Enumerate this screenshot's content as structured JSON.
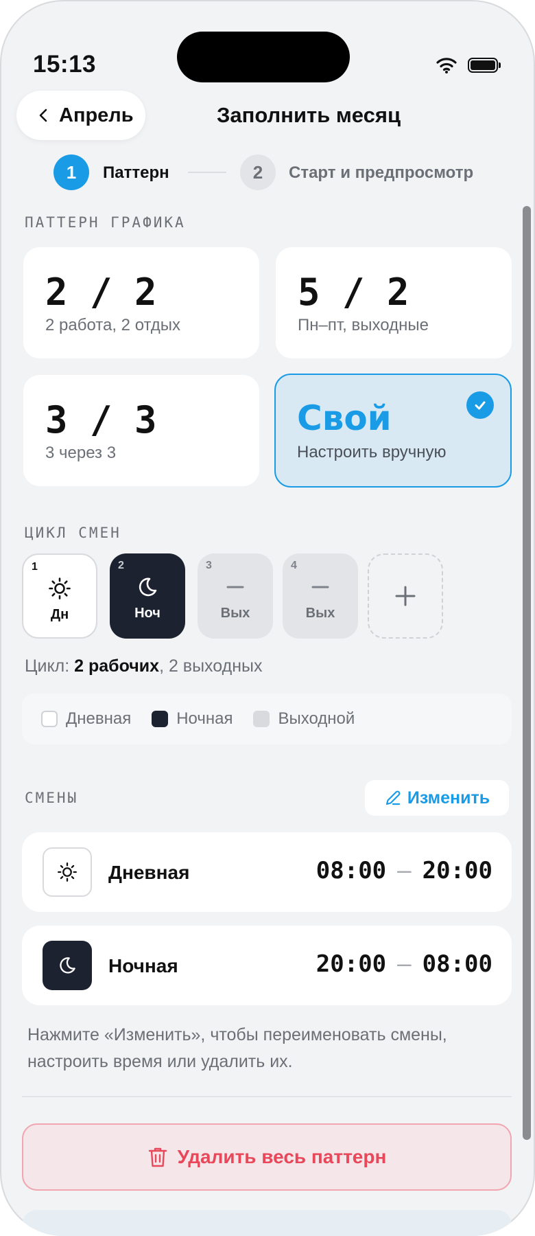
{
  "status_bar": {
    "time": "15:13"
  },
  "nav": {
    "back_label": "Апрель",
    "title": "Заполнить месяц"
  },
  "steps": [
    {
      "number": "1",
      "label": "Паттерн",
      "active": true
    },
    {
      "number": "2",
      "label": "Старт и предпросмотр",
      "active": false
    }
  ],
  "pattern_section": {
    "label": "ПАТТЕРН ГРАФИКА",
    "cards": [
      {
        "title": "2 / 2",
        "subtitle": "2 работа, 2 отдых"
      },
      {
        "title": "5 / 2",
        "subtitle": "Пн–пт, выходные"
      },
      {
        "title": "3 / 3",
        "subtitle": "3 через 3"
      },
      {
        "title": "Свой",
        "subtitle": "Настроить вручную",
        "selected": true
      }
    ]
  },
  "cycle_section": {
    "label": "ЦИКЛ СМЕН",
    "tiles": [
      {
        "number": "1",
        "label": "Дн",
        "icon": "sun-icon"
      },
      {
        "number": "2",
        "label": "Ноч",
        "icon": "moon-icon"
      },
      {
        "number": "3",
        "label": "Вых",
        "icon": "minus-icon"
      },
      {
        "number": "4",
        "label": "Вых",
        "icon": "minus-icon"
      }
    ],
    "add_icon": "plus-icon",
    "summary_prefix": "Цикл: ",
    "summary_bold": "2 рабочих",
    "summary_suffix": ", 2 выходных",
    "legend": [
      {
        "label": "Дневная",
        "color": "#ffffff"
      },
      {
        "label": "Ночная",
        "color": "#1c2230"
      },
      {
        "label": "Выходной",
        "color": "#d9dadd"
      }
    ]
  },
  "shifts_section": {
    "label": "СМЕНЫ",
    "edit_label": "Изменить",
    "shifts": [
      {
        "name": "Дневная",
        "start": "08:00",
        "dash": "—",
        "end": "20:00",
        "icon": "sun-icon"
      },
      {
        "name": "Ночная",
        "start": "20:00",
        "dash": "—",
        "end": "08:00",
        "icon": "moon-icon"
      }
    ],
    "hint": "Нажмите «Изменить», чтобы переименовать смены, настроить время или удалить их."
  },
  "delete_label": "Удалить весь паттерн",
  "colors": {
    "accent": "#1a9be6",
    "danger": "#e8485a",
    "night": "#1c2230"
  }
}
